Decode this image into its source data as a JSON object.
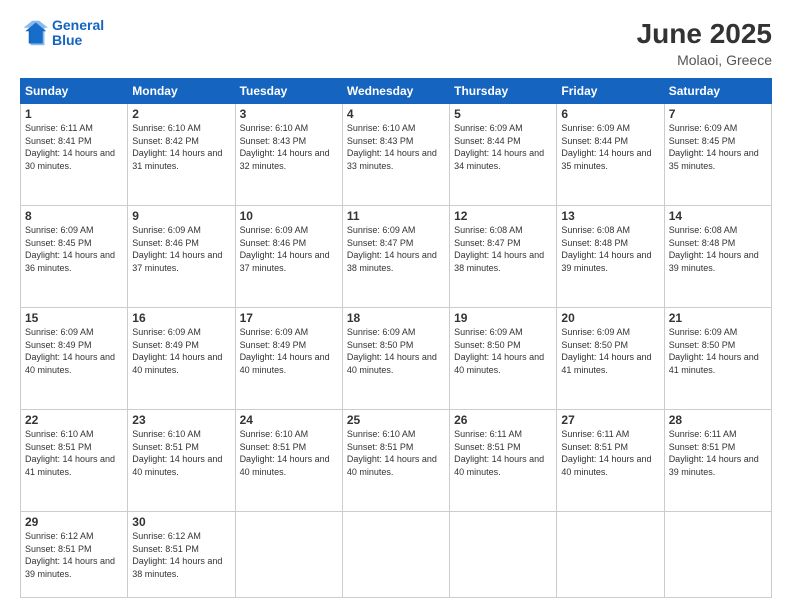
{
  "logo": {
    "line1": "General",
    "line2": "Blue"
  },
  "title": "June 2025",
  "location": "Molaoi, Greece",
  "days_header": [
    "Sunday",
    "Monday",
    "Tuesday",
    "Wednesday",
    "Thursday",
    "Friday",
    "Saturday"
  ],
  "weeks": [
    [
      {
        "num": "1",
        "rise": "6:11 AM",
        "set": "8:41 PM",
        "daylight": "14 hours and 30 minutes."
      },
      {
        "num": "2",
        "rise": "6:10 AM",
        "set": "8:42 PM",
        "daylight": "14 hours and 31 minutes."
      },
      {
        "num": "3",
        "rise": "6:10 AM",
        "set": "8:43 PM",
        "daylight": "14 hours and 32 minutes."
      },
      {
        "num": "4",
        "rise": "6:10 AM",
        "set": "8:43 PM",
        "daylight": "14 hours and 33 minutes."
      },
      {
        "num": "5",
        "rise": "6:09 AM",
        "set": "8:44 PM",
        "daylight": "14 hours and 34 minutes."
      },
      {
        "num": "6",
        "rise": "6:09 AM",
        "set": "8:44 PM",
        "daylight": "14 hours and 35 minutes."
      },
      {
        "num": "7",
        "rise": "6:09 AM",
        "set": "8:45 PM",
        "daylight": "14 hours and 35 minutes."
      }
    ],
    [
      {
        "num": "8",
        "rise": "6:09 AM",
        "set": "8:45 PM",
        "daylight": "14 hours and 36 minutes."
      },
      {
        "num": "9",
        "rise": "6:09 AM",
        "set": "8:46 PM",
        "daylight": "14 hours and 37 minutes."
      },
      {
        "num": "10",
        "rise": "6:09 AM",
        "set": "8:46 PM",
        "daylight": "14 hours and 37 minutes."
      },
      {
        "num": "11",
        "rise": "6:09 AM",
        "set": "8:47 PM",
        "daylight": "14 hours and 38 minutes."
      },
      {
        "num": "12",
        "rise": "6:08 AM",
        "set": "8:47 PM",
        "daylight": "14 hours and 38 minutes."
      },
      {
        "num": "13",
        "rise": "6:08 AM",
        "set": "8:48 PM",
        "daylight": "14 hours and 39 minutes."
      },
      {
        "num": "14",
        "rise": "6:08 AM",
        "set": "8:48 PM",
        "daylight": "14 hours and 39 minutes."
      }
    ],
    [
      {
        "num": "15",
        "rise": "6:09 AM",
        "set": "8:49 PM",
        "daylight": "14 hours and 40 minutes."
      },
      {
        "num": "16",
        "rise": "6:09 AM",
        "set": "8:49 PM",
        "daylight": "14 hours and 40 minutes."
      },
      {
        "num": "17",
        "rise": "6:09 AM",
        "set": "8:49 PM",
        "daylight": "14 hours and 40 minutes."
      },
      {
        "num": "18",
        "rise": "6:09 AM",
        "set": "8:50 PM",
        "daylight": "14 hours and 40 minutes."
      },
      {
        "num": "19",
        "rise": "6:09 AM",
        "set": "8:50 PM",
        "daylight": "14 hours and 40 minutes."
      },
      {
        "num": "20",
        "rise": "6:09 AM",
        "set": "8:50 PM",
        "daylight": "14 hours and 41 minutes."
      },
      {
        "num": "21",
        "rise": "6:09 AM",
        "set": "8:50 PM",
        "daylight": "14 hours and 41 minutes."
      }
    ],
    [
      {
        "num": "22",
        "rise": "6:10 AM",
        "set": "8:51 PM",
        "daylight": "14 hours and 41 minutes."
      },
      {
        "num": "23",
        "rise": "6:10 AM",
        "set": "8:51 PM",
        "daylight": "14 hours and 40 minutes."
      },
      {
        "num": "24",
        "rise": "6:10 AM",
        "set": "8:51 PM",
        "daylight": "14 hours and 40 minutes."
      },
      {
        "num": "25",
        "rise": "6:10 AM",
        "set": "8:51 PM",
        "daylight": "14 hours and 40 minutes."
      },
      {
        "num": "26",
        "rise": "6:11 AM",
        "set": "8:51 PM",
        "daylight": "14 hours and 40 minutes."
      },
      {
        "num": "27",
        "rise": "6:11 AM",
        "set": "8:51 PM",
        "daylight": "14 hours and 40 minutes."
      },
      {
        "num": "28",
        "rise": "6:11 AM",
        "set": "8:51 PM",
        "daylight": "14 hours and 39 minutes."
      }
    ],
    [
      {
        "num": "29",
        "rise": "6:12 AM",
        "set": "8:51 PM",
        "daylight": "14 hours and 39 minutes."
      },
      {
        "num": "30",
        "rise": "6:12 AM",
        "set": "8:51 PM",
        "daylight": "14 hours and 38 minutes."
      },
      null,
      null,
      null,
      null,
      null
    ]
  ]
}
